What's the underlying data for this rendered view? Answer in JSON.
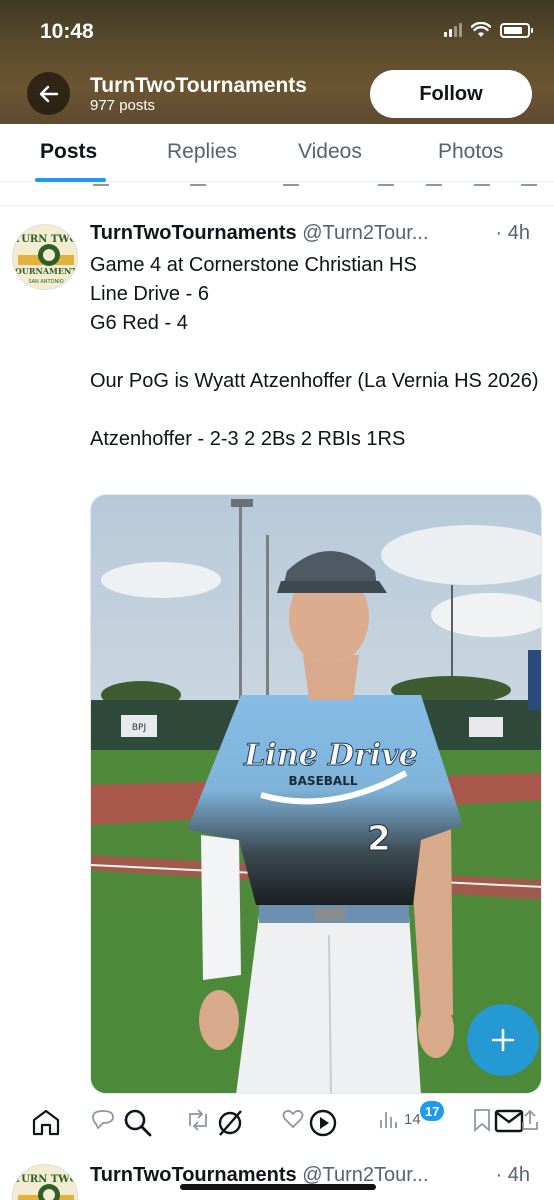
{
  "status_bar": {
    "time": "10:48"
  },
  "profile": {
    "name": "TurnTwoTournaments",
    "posts_count": "977 posts",
    "follow_label": "Follow"
  },
  "tabs": [
    {
      "label": "Posts",
      "active": true
    },
    {
      "label": "Replies",
      "active": false
    },
    {
      "label": "Videos",
      "active": false
    },
    {
      "label": "Photos",
      "active": false
    }
  ],
  "tweet": {
    "author_name": "TurnTwoTournaments",
    "author_handle": "@Turn2Tour...",
    "time": "4h",
    "lines": [
      "Game 4 at Cornerstone Christian HS",
      "Line Drive - 6",
      "G6 Red - 4",
      "",
      "Our PoG is Wyatt Atzenhoffer (La Vernia HS 2026)",
      "",
      "Atzenhoffer - 2-3 2 2Bs 2 RBIs 1RS"
    ],
    "photo": {
      "jersey_script": "Line Drive",
      "jersey_word": "BASEBALL",
      "jersey_number": "2",
      "sign_label": "BPJ"
    },
    "views_count": "14"
  },
  "bottom_nav": {
    "notifications_badge": "17"
  },
  "next_tweet": {
    "author_name": "TurnTwoTournaments",
    "author_handle": "@Turn2Tour...",
    "time": "4h"
  },
  "avatar_text": {
    "top": "TURN TWO",
    "bottom": "TOURNAMENTS",
    "city": "SAN ANTONIO"
  },
  "colors": {
    "accent": "#1d9bf0",
    "text": "#0f1419",
    "muted": "#536471"
  }
}
